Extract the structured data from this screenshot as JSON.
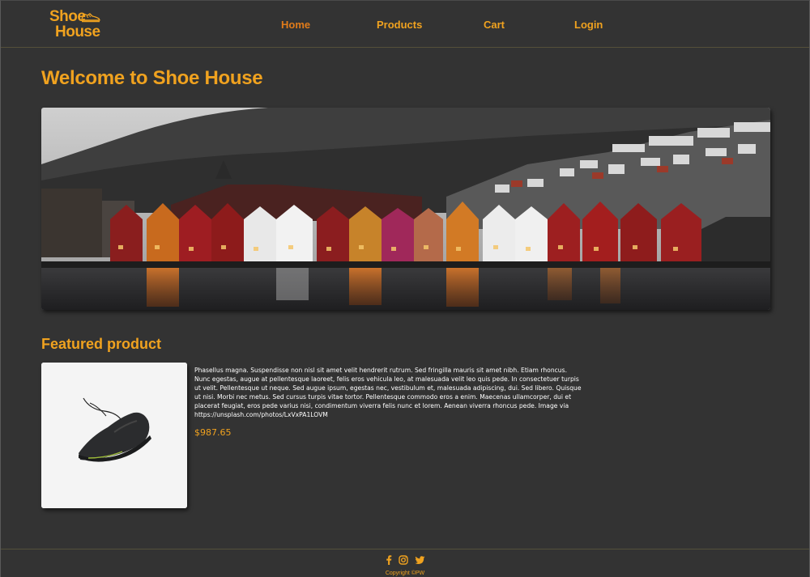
{
  "brand": {
    "line1": "Shoe",
    "line2": "House",
    "color": "#f0a21f",
    "icon": "sneaker-icon"
  },
  "nav": {
    "home": "Home",
    "products": "Products",
    "cart": "Cart",
    "login": "Login",
    "active": "home"
  },
  "main": {
    "title": "Welcome to Shoe House",
    "featured_title": "Featured product",
    "product": {
      "description": "Phasellus magna. Suspendisse non nisl sit amet velit hendrerit rutrum. Sed fringilla mauris sit amet nibh. Etiam rhoncus. Nunc egestas, augue at pellentesque laoreet, felis eros vehicula leo, at malesuada velit leo quis pede. In consectetuer turpis ut velit. Pellentesque ut neque. Sed augue ipsum, egestas nec, vestibulum et, malesuada adipiscing, dui. Sed libero. Quisque ut nisi. Morbi nec metus. Sed cursus turpis vitae tortor. Pellentesque commodo eros a enim. Maecenas ullamcorper, dui et placerat feugiat, eros pede varius nisi, condimentum viverra felis nunc et lorem. Aenean viverra rhoncus pede. Image via https://unsplash.com/photos/LxVxPA1LOVM",
      "price": "$987.65"
    }
  },
  "footer": {
    "social": [
      "facebook-icon",
      "instagram-icon",
      "twitter-icon"
    ],
    "copyright": "Copyright ©PW"
  },
  "colors": {
    "background": "#333333",
    "accent": "#f0a21f",
    "nav_active": "#e07b1a",
    "text": "#ffffff"
  }
}
